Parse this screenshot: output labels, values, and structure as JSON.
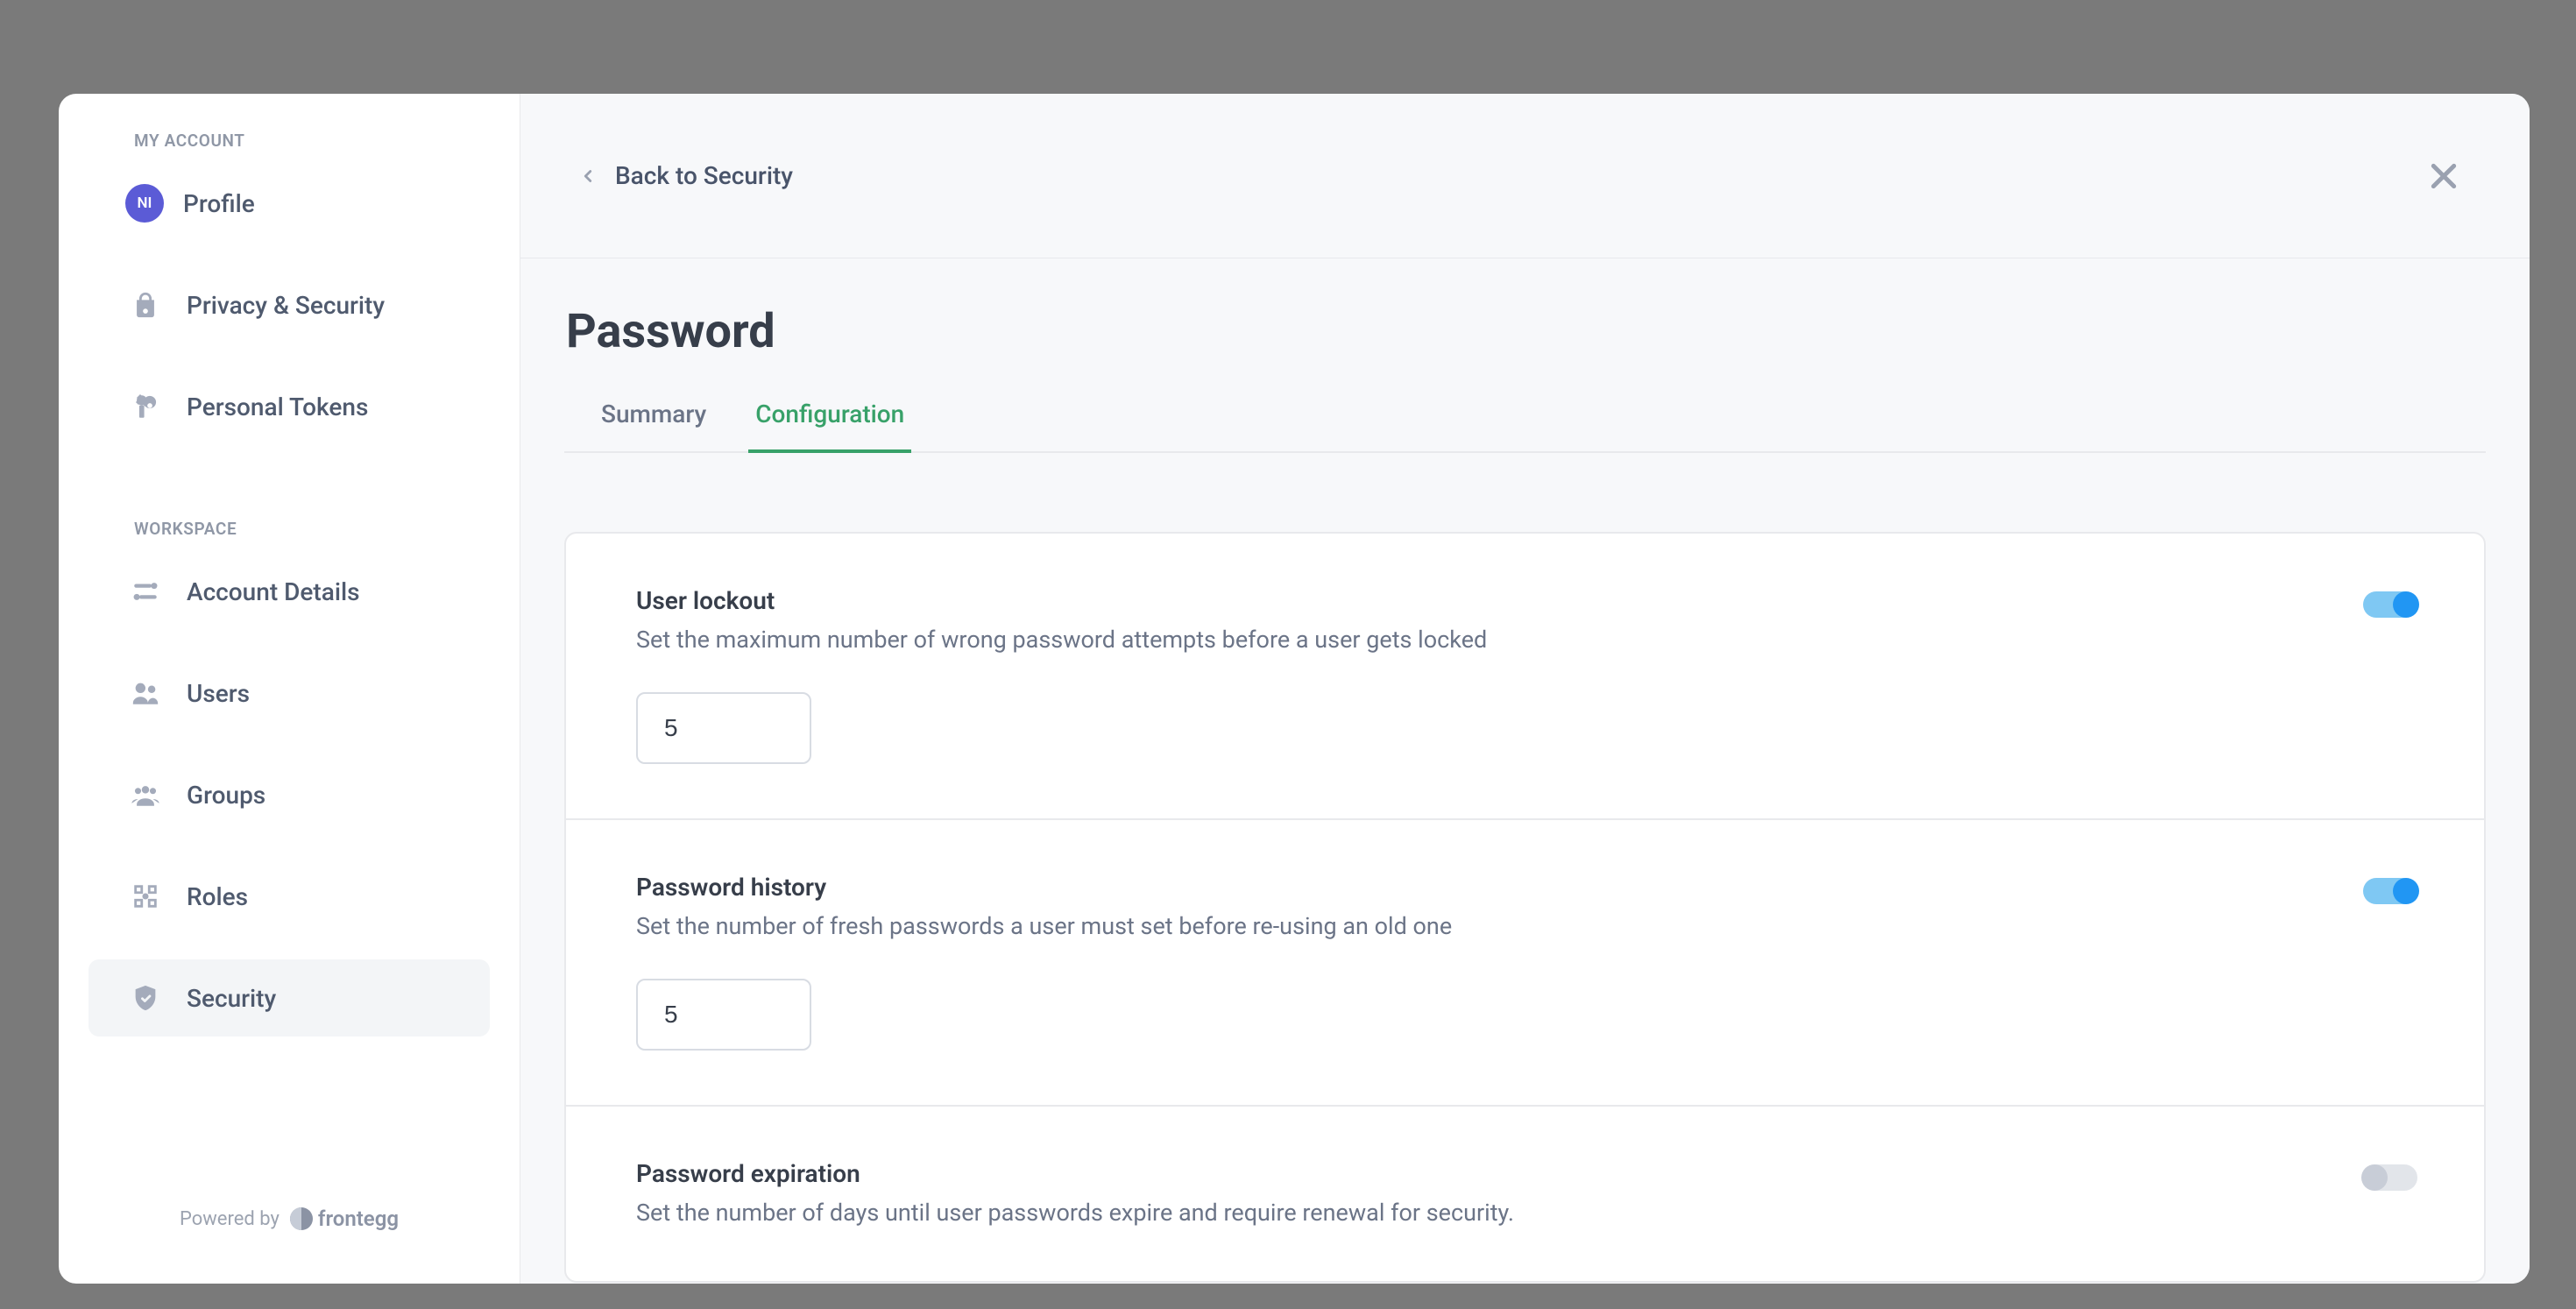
{
  "sidebar": {
    "sections": {
      "account_label": "MY ACCOUNT",
      "workspace_label": "WORKSPACE"
    },
    "avatar_initials": "NI",
    "items_account": [
      {
        "label": "Profile"
      },
      {
        "label": "Privacy & Security"
      },
      {
        "label": "Personal Tokens"
      }
    ],
    "items_workspace": [
      {
        "label": "Account Details"
      },
      {
        "label": "Users"
      },
      {
        "label": "Groups"
      },
      {
        "label": "Roles"
      },
      {
        "label": "Security"
      }
    ],
    "powered_by_label": "Powered by",
    "brand_name": "frontegg"
  },
  "topbar": {
    "back_label": "Back to Security"
  },
  "page": {
    "title": "Password",
    "tabs": {
      "summary": "Summary",
      "configuration": "Configuration"
    }
  },
  "settings": {
    "user_lockout": {
      "title": "User lockout",
      "desc": "Set the maximum number of wrong password attempts before a user gets locked",
      "value": "5",
      "enabled": true
    },
    "password_history": {
      "title": "Password history",
      "desc": "Set the number of fresh passwords a user must set before re-using an old one",
      "value": "5",
      "enabled": true
    },
    "password_expiration": {
      "title": "Password expiration",
      "desc": "Set the number of days until user passwords expire and require renewal for security.",
      "enabled": false
    }
  }
}
